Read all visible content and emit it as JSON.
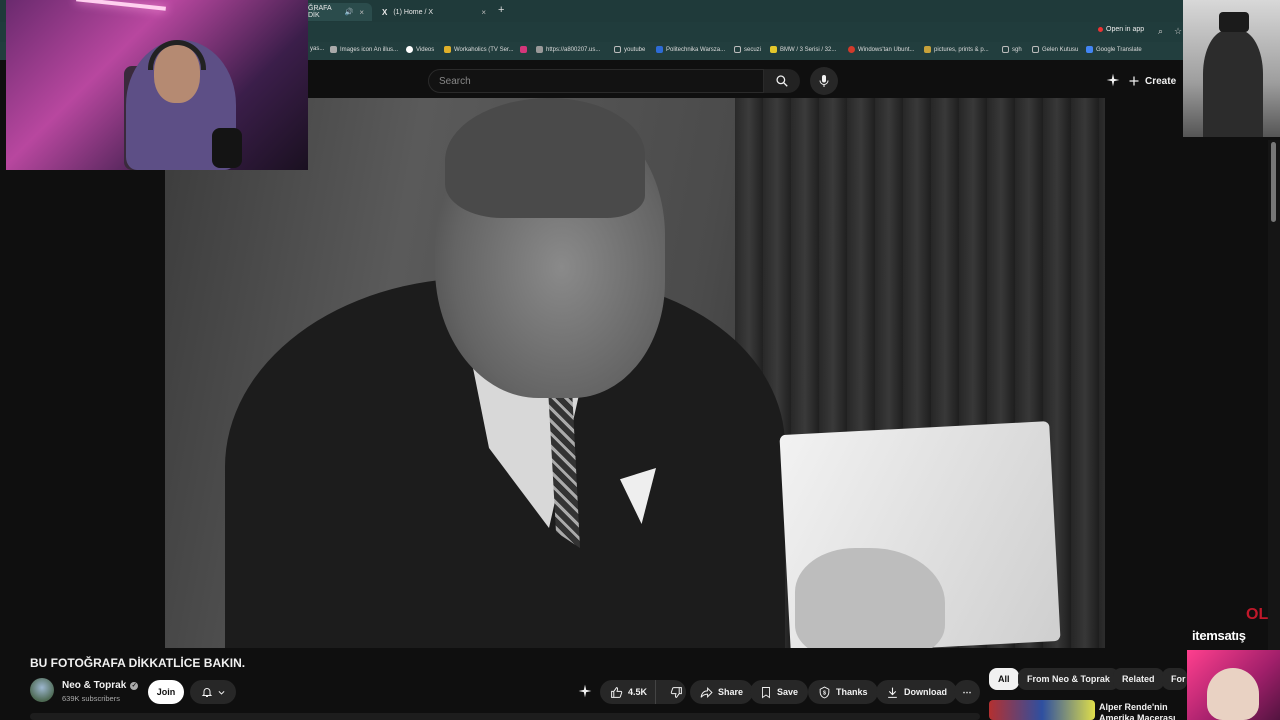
{
  "browser": {
    "tabs": [
      {
        "label": "ĞRAFA DİK",
        "active": true
      },
      {
        "label": "(1) Home / X",
        "active": false
      }
    ],
    "new_tab": "+",
    "open_in_app": "Open in app",
    "bookmarks": [
      "yas...",
      "Images icon An illus...",
      "Videos",
      "Workaholics (TV Ser...",
      "https://a800207.us...",
      "youtube",
      "Politechnika Warsza...",
      "secuzi",
      "BMW / 3 Serisi / 32...",
      "Windows'tan Ubunt...",
      "pictures, prints & p...",
      "sgh",
      "Gelen Kutusu",
      "Google Translate"
    ],
    "bookmark_colors": [
      "#888888",
      "#aaaaaa",
      "#2f6fe0",
      "#e0b02a",
      "#d4367a",
      "#999999",
      "#999999",
      "#2d6bd6",
      "#999999",
      "#e3c72b",
      "#d23a2a",
      "#c7a13a",
      "#999999",
      "#999999",
      "#4285f4"
    ]
  },
  "youtube": {
    "search_placeholder": "Search",
    "create_label": "Create"
  },
  "video": {
    "title": "BU FOTOĞRAFA DİKKATLİCE BAKIN."
  },
  "channel": {
    "name": "Neo & Toprak",
    "subscribers": "639K subscribers",
    "join_label": "Join"
  },
  "actions": {
    "likes": "4.5K",
    "share": "Share",
    "save": "Save",
    "thanks": "Thanks",
    "download": "Download",
    "more": "⋯"
  },
  "chips": [
    "All",
    "From Neo & Toprak",
    "Related",
    "For y"
  ],
  "recommendation": {
    "title": "Alper Rende'nin Amerika Macerası Yorumluyo"
  },
  "overlay": {
    "brand": "itemsatış",
    "brand_mark": "OL"
  }
}
